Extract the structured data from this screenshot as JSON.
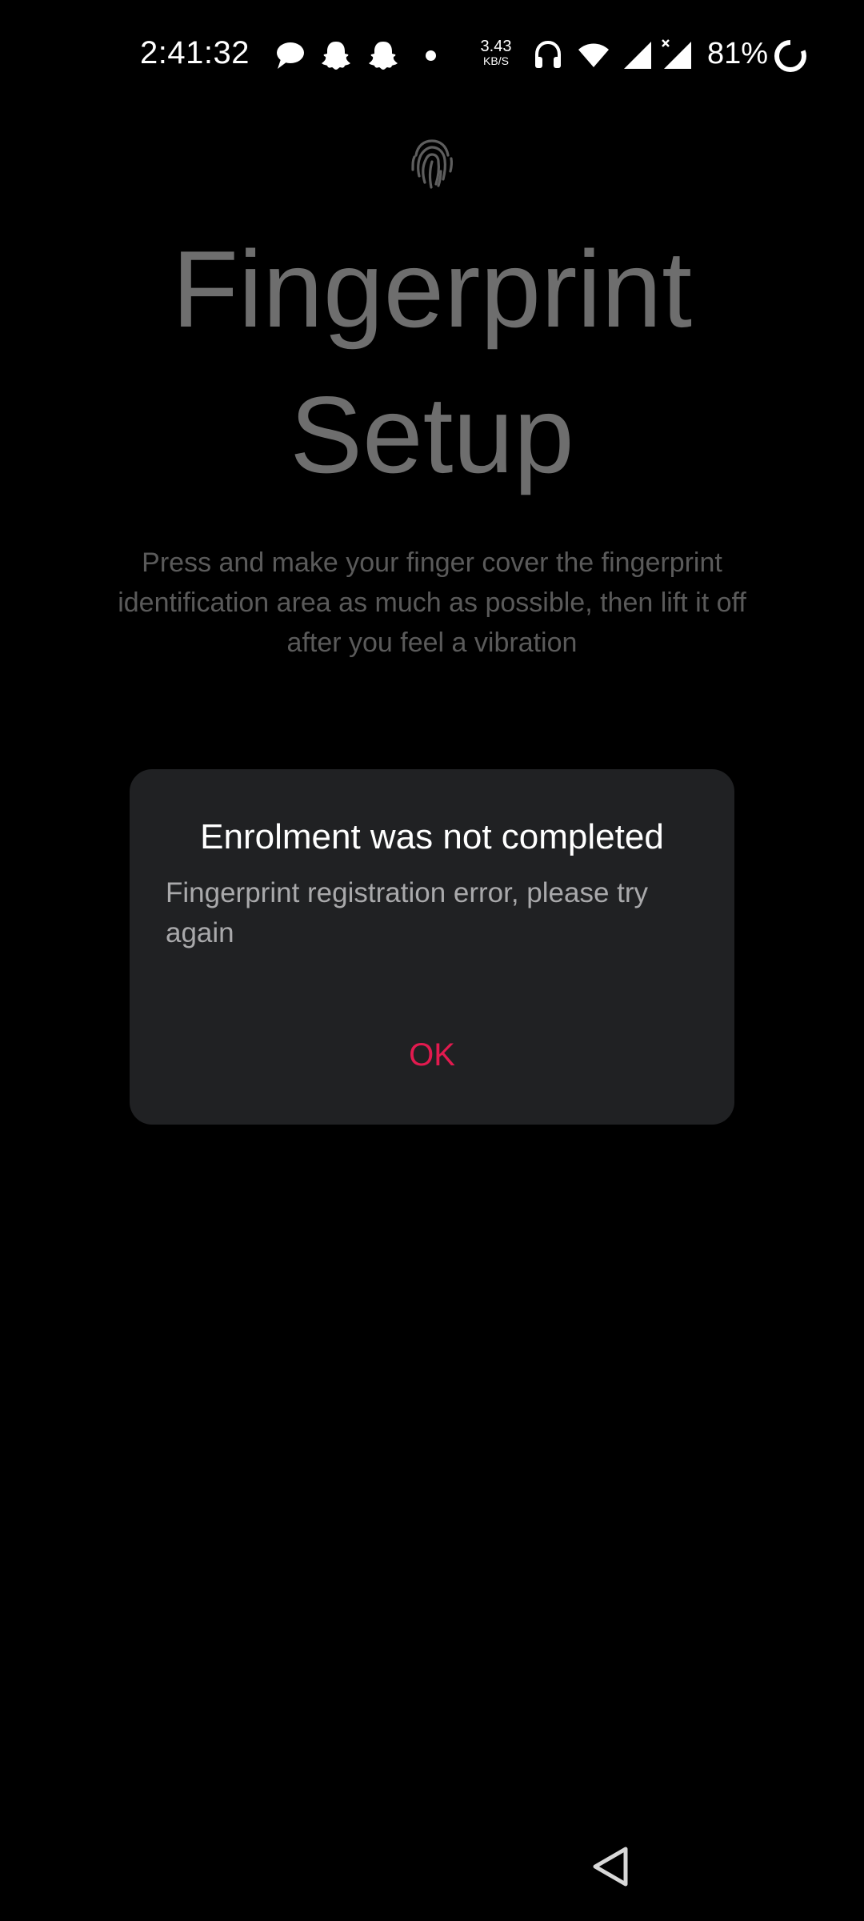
{
  "status_bar": {
    "time": "2:41:32",
    "icons": [
      "chat-bubble-icon",
      "snapchat-ghost-icon",
      "snapchat-ghost-icon",
      "notification-dot-icon",
      "headset-icon",
      "wifi-icon",
      "cell-signal-icon",
      "cell-signal-no-data-icon",
      "battery-ring-icon"
    ],
    "net_speed_value": "3.43",
    "net_speed_unit": "KB/S",
    "battery": "81%"
  },
  "setup": {
    "icon": "fingerprint-icon",
    "title_line1": "Fingerprint",
    "title_line2": "Setup",
    "description": "Press and make your finger cover the fingerprint identification area as much as possible, then lift it off after you feel a vibration"
  },
  "dialog": {
    "title": "Enrolment was not completed",
    "message": "Fingerprint registration error, please try again",
    "ok_label": "OK"
  },
  "nav_bar": {
    "back_icon": "back-triangle-icon"
  },
  "colors": {
    "background": "#000000",
    "dialog_background": "#202123",
    "accent": "#e21a4f",
    "title_dimmed": "#6e6e6e",
    "description_dimmed": "#5a5a5a"
  }
}
